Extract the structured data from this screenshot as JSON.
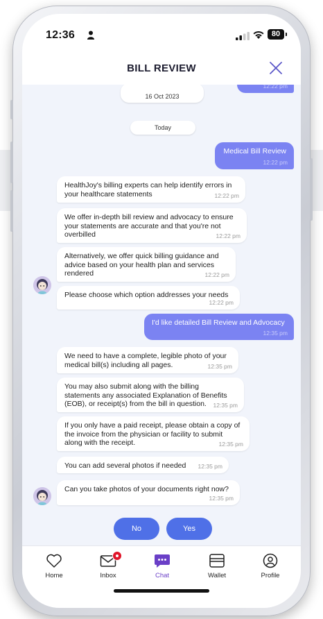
{
  "status_bar": {
    "time": "12:36",
    "battery": "80"
  },
  "header": {
    "title": "BILL REVIEW",
    "close_icon": "close-icon"
  },
  "chat": {
    "top_partial_time": "12:22 pm",
    "date_old": "16 Oct 2023",
    "date_today": "Today",
    "messages": [
      {
        "from": "user",
        "text": "Medical Bill Review",
        "time": "12:22 pm"
      },
      {
        "from": "bot",
        "text": "HealthJoy's billing experts can help identify errors in your healthcare statements",
        "time": "12:22 pm"
      },
      {
        "from": "bot",
        "text": "We offer in-depth bill review and advocacy to ensure your statements are accurate and that you're not overbilled",
        "time": "12:22 pm"
      },
      {
        "from": "bot",
        "text": "Alternatively, we offer quick billing guidance and advice based on your health plan and services rendered",
        "time": "12:22 pm"
      },
      {
        "from": "bot",
        "text": "Please choose which option addresses your needs",
        "time": "12:22 pm"
      },
      {
        "from": "user",
        "text": "I'd like detailed Bill Review and Advocacy",
        "time": "12:35 pm"
      },
      {
        "from": "bot",
        "text": "We need to have a complete, legible photo of your medical bill(s) including all pages.",
        "time": "12:35 pm"
      },
      {
        "from": "bot",
        "text": "You may also submit along with the billing statements any associated Explanation of Benefits (EOB), or receipt(s) from the bill in question.",
        "time": "12:35 pm"
      },
      {
        "from": "bot",
        "text": "If you only have a paid receipt, please obtain a copy of the invoice from the physician or facility to submit along with the receipt.",
        "time": "12:35 pm"
      },
      {
        "from": "bot",
        "text": "You can add several photos if needed",
        "time": "12:35 pm"
      },
      {
        "from": "bot",
        "text": "Can you take photos of your documents right now?",
        "time": "12:35 pm"
      }
    ],
    "choices": {
      "no": "No",
      "yes": "Yes"
    }
  },
  "nav": {
    "items": [
      {
        "label": "Home",
        "icon": "heart-icon"
      },
      {
        "label": "Inbox",
        "icon": "envelope-icon"
      },
      {
        "label": "Chat",
        "icon": "chat-icon"
      },
      {
        "label": "Wallet",
        "icon": "wallet-icon"
      },
      {
        "label": "Profile",
        "icon": "profile-icon"
      }
    ],
    "active": "Chat"
  },
  "colors": {
    "user_bubble": "#7b83f2",
    "choice_button": "#4f70e7",
    "active_nav": "#6a3fc7",
    "badge": "#e0152a",
    "chat_bg": "#f1f4fb"
  }
}
